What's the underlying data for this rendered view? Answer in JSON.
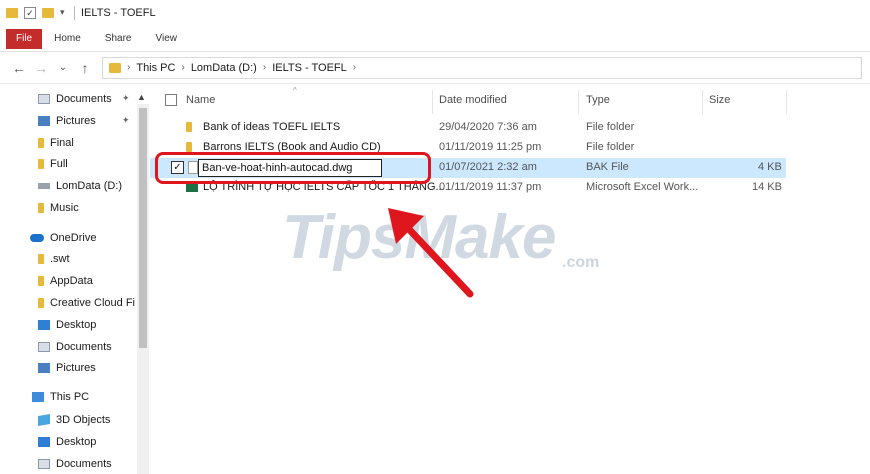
{
  "window": {
    "title": "IELTS - TOEFL"
  },
  "ribbon": {
    "tabs": [
      "File",
      "Home",
      "Share",
      "View"
    ]
  },
  "address": {
    "crumbs": [
      "This PC",
      "LomData (D:)",
      "IELTS - TOEFL"
    ]
  },
  "sidebar": {
    "items": [
      {
        "label": "Documents",
        "icon": "documents-icon",
        "pinned": true
      },
      {
        "label": "Pictures",
        "icon": "pictures-icon",
        "pinned": true
      },
      {
        "label": "Final",
        "icon": "folder-icon"
      },
      {
        "label": "Full",
        "icon": "folder-icon"
      },
      {
        "label": "LomData (D:)",
        "icon": "drive-icon"
      },
      {
        "label": "Music",
        "icon": "folder-icon"
      },
      {
        "label": "OneDrive",
        "icon": "onedrive-icon"
      },
      {
        "label": ".swt",
        "icon": "folder-icon"
      },
      {
        "label": "AppData",
        "icon": "folder-icon"
      },
      {
        "label": "Creative Cloud Fi",
        "icon": "folder-icon"
      },
      {
        "label": "Desktop",
        "icon": "desktop-icon"
      },
      {
        "label": "Documents",
        "icon": "documents-icon"
      },
      {
        "label": "Pictures",
        "icon": "pictures-icon"
      },
      {
        "label": "This PC",
        "icon": "pc-icon"
      },
      {
        "label": "3D Objects",
        "icon": "3d-objects-icon"
      },
      {
        "label": "Desktop",
        "icon": "desktop-icon"
      },
      {
        "label": "Documents",
        "icon": "documents-icon"
      }
    ]
  },
  "columns": {
    "name": "Name",
    "date": "Date modified",
    "type": "Type",
    "size": "Size"
  },
  "files": [
    {
      "name": "Bank of ideas TOEFL IELTS",
      "date": "29/04/2020 7:36 am",
      "type": "File folder",
      "size": "",
      "icon": "folder-icon"
    },
    {
      "name": "Barrons IELTS (Book and Audio CD)",
      "date": "01/11/2019 11:25 pm",
      "type": "File folder",
      "size": "",
      "icon": "folder-icon"
    },
    {
      "name": "Ban-ve-hoat-hinh-autocad.dwg",
      "date": "01/07/2021 2:32 am",
      "type": "BAK File",
      "size": "4 KB",
      "icon": "file-icon",
      "selected": true,
      "renaming": true
    },
    {
      "name": "LỘ TRÌNH TỰ HỌC IELTS CẤP TỐC 1 THÁNG...",
      "date": "01/11/2019 11:37 pm",
      "type": "Microsoft Excel Work...",
      "size": "14 KB",
      "icon": "excel-icon"
    }
  ],
  "watermark": {
    "main": "TipsMake",
    "suffix": ".com"
  },
  "colors": {
    "accent": "#c42b2b",
    "selection": "#cce8ff",
    "highlight": "#e0161e",
    "folder": "#e6b93b"
  }
}
